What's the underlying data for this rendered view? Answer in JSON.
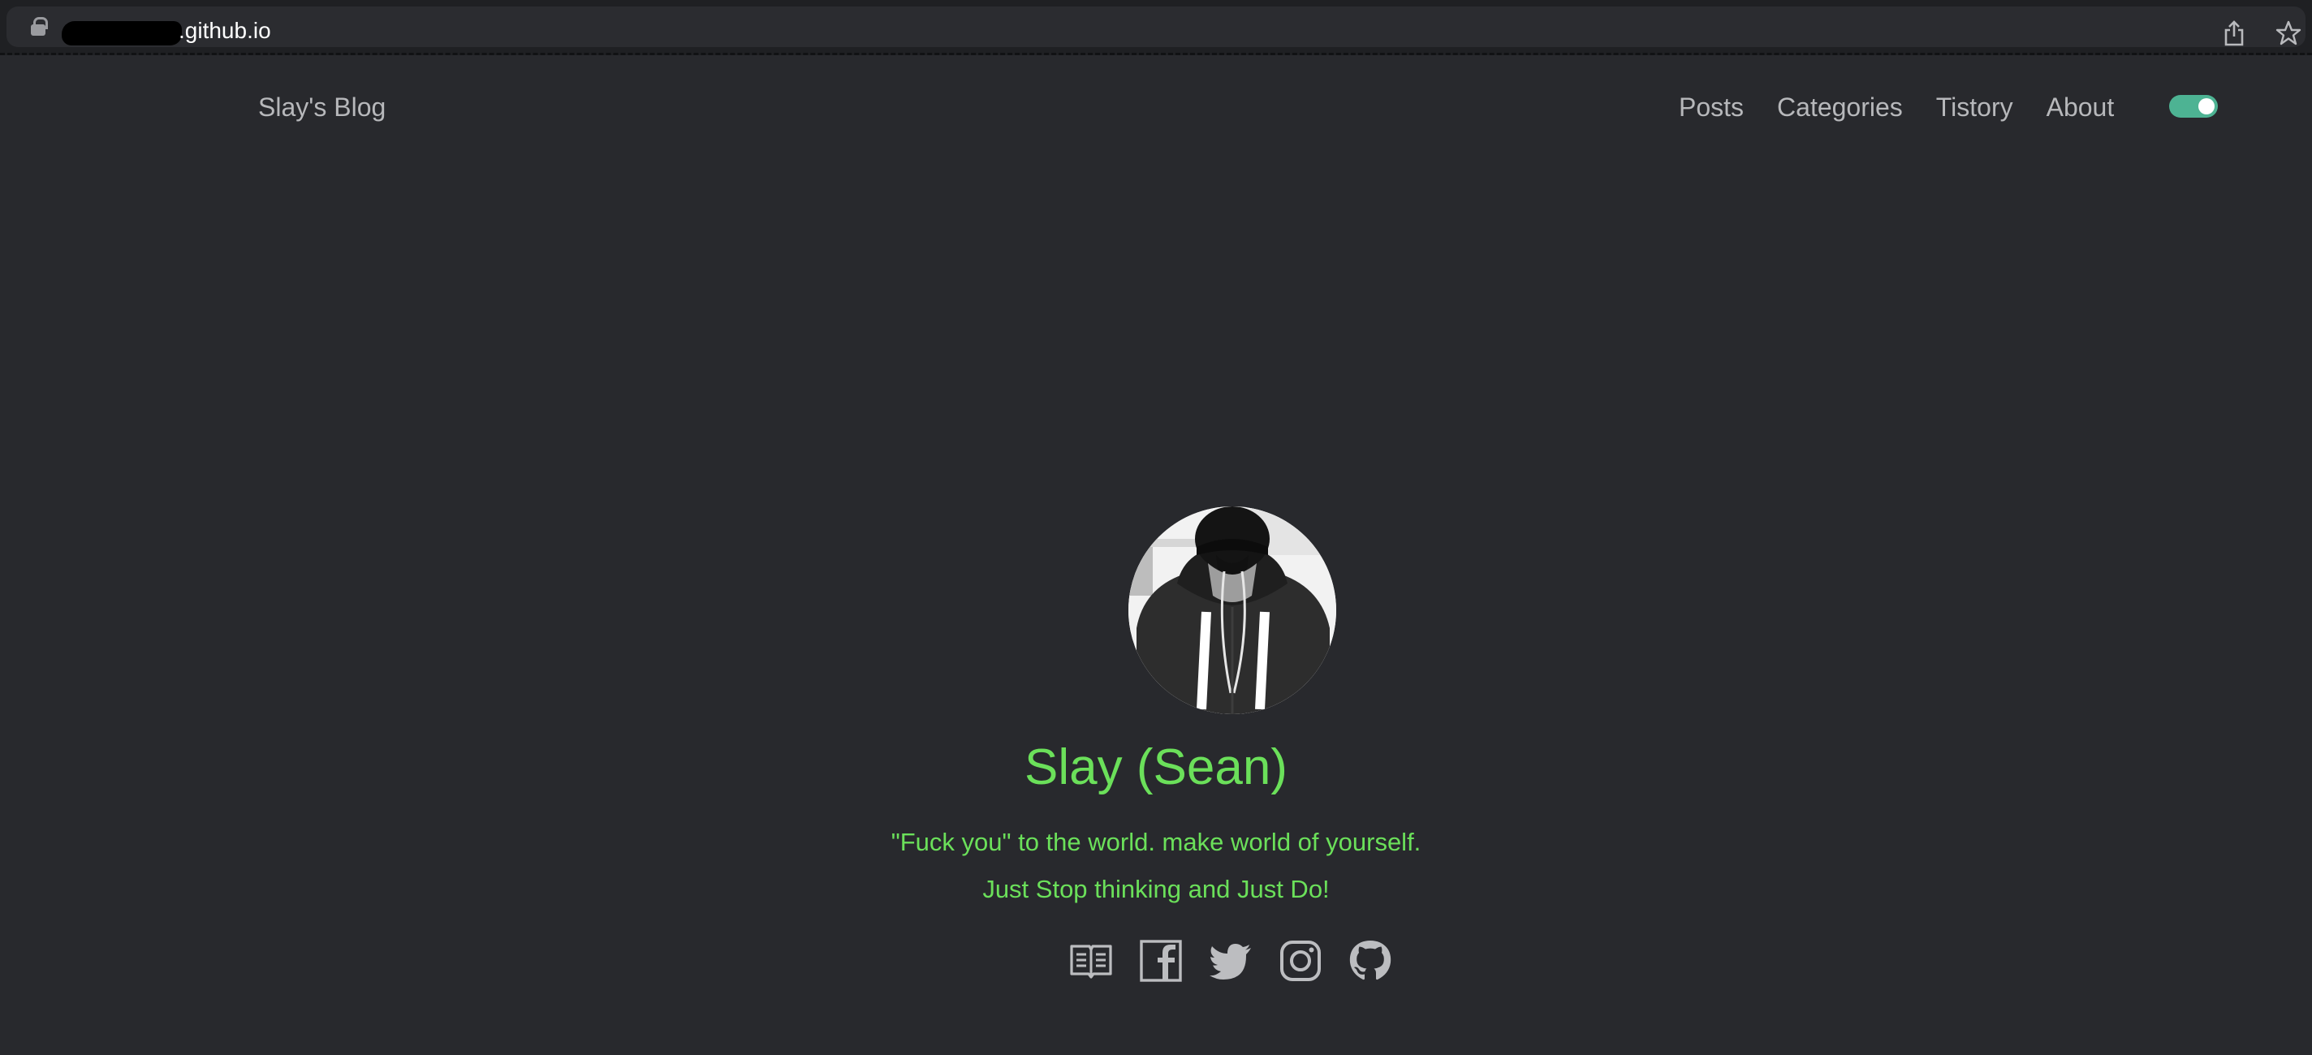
{
  "browser": {
    "url": ".github.io"
  },
  "header": {
    "brand": "Slay's Blog",
    "nav": [
      {
        "label": "Posts"
      },
      {
        "label": "Categories"
      },
      {
        "label": "Tistory"
      },
      {
        "label": "About"
      }
    ],
    "theme_toggle_on": true
  },
  "profile": {
    "name": "Slay (Sean)",
    "quote_line1": "\"Fuck you\" to the world. make world of yourself.",
    "quote_line2": "Just Stop thinking and Just Do!"
  },
  "social": [
    {
      "icon": "book-icon"
    },
    {
      "icon": "facebook-icon"
    },
    {
      "icon": "twitter-icon"
    },
    {
      "icon": "instagram-icon"
    },
    {
      "icon": "github-icon"
    }
  ],
  "colors": {
    "background": "#28292d",
    "accent_green": "#6be05a",
    "toggle": "#4db393",
    "nav_text": "#b7b8bb"
  }
}
